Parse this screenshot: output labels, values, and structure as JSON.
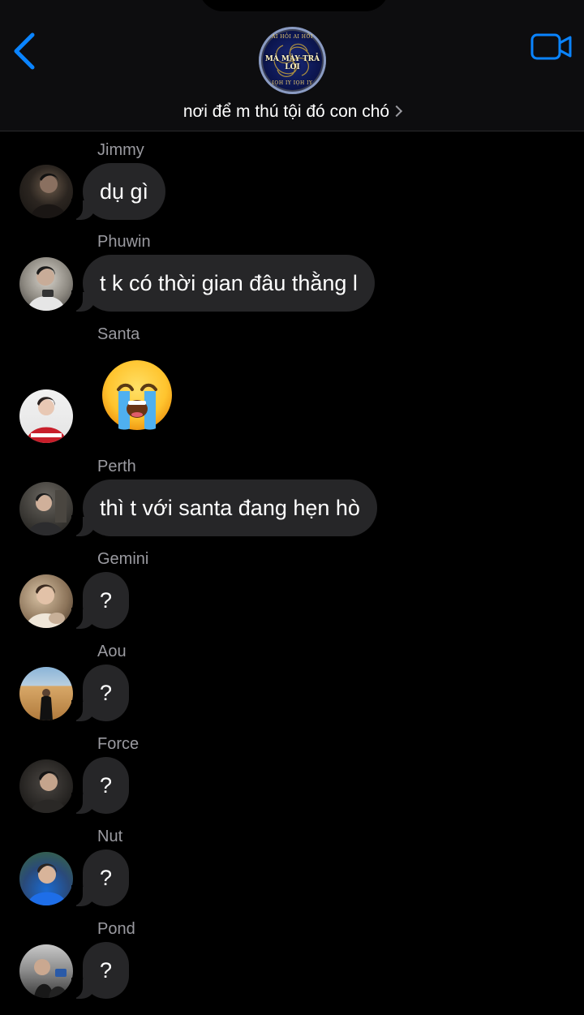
{
  "header": {
    "title": "nơi để m thú tội đó con chó",
    "group_avatar": {
      "line_top": "AI HỎI AI HỎI",
      "line_mid": "MÀ MÀY TRẢ LỜI",
      "line_bottom": "IỌH IY IỌH IY"
    },
    "icons": {
      "back": "chevron-left-icon",
      "video": "video-camera-icon",
      "title_chevron": "chevron-right-icon"
    },
    "accent_color": "#0a84ff"
  },
  "messages": [
    {
      "sender": "Jimmy",
      "text": "dụ gì"
    },
    {
      "sender": "Phuwin",
      "text": "t k có thời gian đâu thằng l"
    },
    {
      "sender": "Santa",
      "emoji": "loudly-crying-face"
    },
    {
      "sender": "Perth",
      "text": "thì t với santa đang hẹn hò"
    },
    {
      "sender": "Gemini",
      "text": "?"
    },
    {
      "sender": "Aou",
      "text": "?"
    },
    {
      "sender": "Force",
      "text": "?"
    },
    {
      "sender": "Nut",
      "text": "?"
    },
    {
      "sender": "Pond",
      "text": "?"
    }
  ],
  "colors": {
    "bubble": "#262628",
    "sender_name": "#9a9aa0",
    "background": "#000000"
  }
}
